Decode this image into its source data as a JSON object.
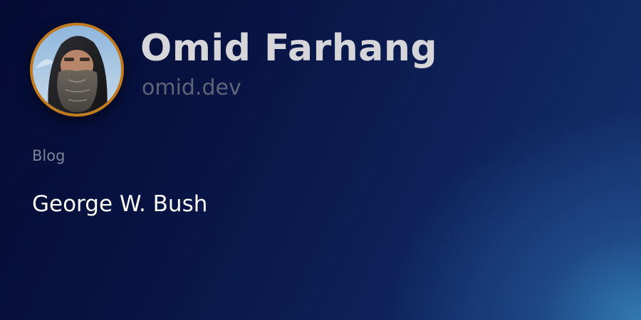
{
  "profile": {
    "name": "Omid Farhang",
    "domain": "omid.dev",
    "avatar_icon": "profile-photo",
    "avatar_border_color": "#c27a1c"
  },
  "post": {
    "section": "Blog",
    "title": "George W. Bush"
  },
  "theme": {
    "background_start": "#050b33",
    "background_end": "#16316c",
    "accent_glow": "#347eb6"
  }
}
